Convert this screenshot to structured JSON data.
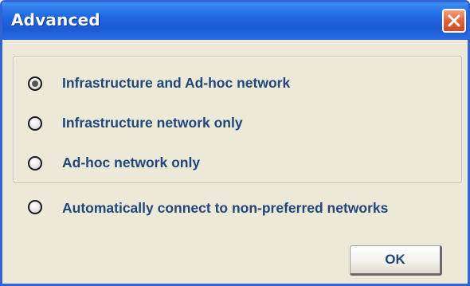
{
  "window": {
    "title": "Advanced"
  },
  "options": [
    {
      "label": "Infrastructure and Ad-hoc network",
      "checked": true
    },
    {
      "label": "Infrastructure  network only",
      "checked": false
    },
    {
      "label": "Ad-hoc network only",
      "checked": false
    }
  ],
  "auto_connect": {
    "label": "Automatically connect to non-preferred networks",
    "checked": false
  },
  "buttons": {
    "ok_label": "OK",
    "close_icon": "close-icon"
  },
  "colors": {
    "titlebar": "#1f66e0",
    "dialog_bg": "#ece9d8",
    "label_text": "#21477a",
    "close_button": "#e2623a"
  }
}
